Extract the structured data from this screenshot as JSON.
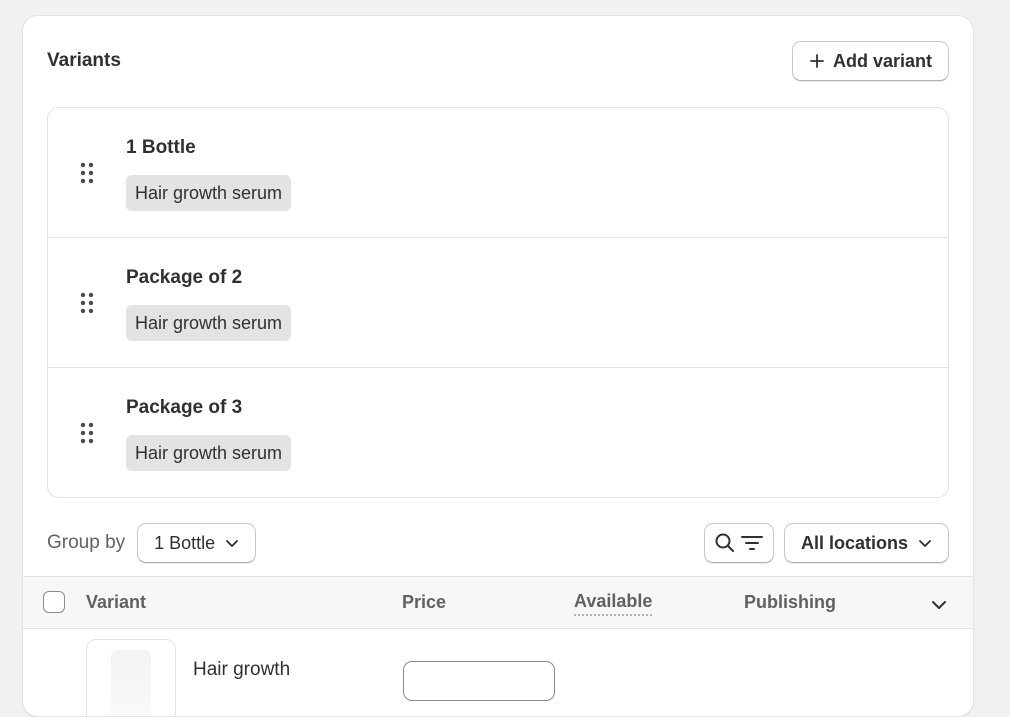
{
  "card": {
    "title": "Variants",
    "add_variant_label": "Add variant"
  },
  "variants": [
    {
      "name": "1 Bottle",
      "tag": "Hair growth serum"
    },
    {
      "name": "Package of 2",
      "tag": "Hair growth serum"
    },
    {
      "name": "Package of 3",
      "tag": "Hair growth serum"
    }
  ],
  "toolbar": {
    "group_by_label": "Group by",
    "group_by_value": "1 Bottle",
    "locations_value": "All locations"
  },
  "table": {
    "columns": {
      "variant": "Variant",
      "price": "Price",
      "available": "Available",
      "publishing": "Publishing"
    },
    "rows": [
      {
        "name": "Hair growth"
      }
    ]
  },
  "icons": {
    "add": "plus-icon",
    "drag": "drag-handle-icon",
    "search": "search-icon",
    "filter": "filter-icon",
    "chevron": "chevron-down-icon"
  },
  "colors": {
    "background": "#f1f1f1",
    "card": "#ffffff",
    "tag": "#e3e3e3",
    "text": "#303030",
    "muted": "#616161"
  }
}
